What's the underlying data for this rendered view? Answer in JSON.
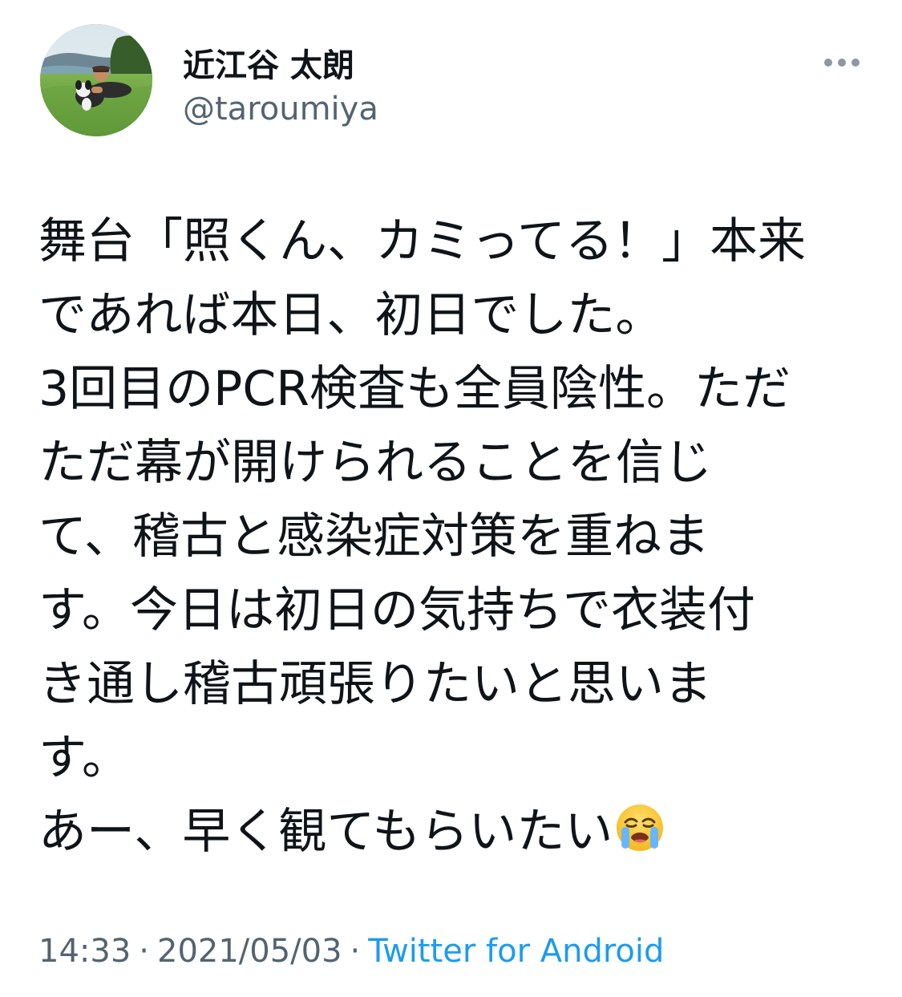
{
  "author": {
    "display_name": "近江谷 太朗",
    "handle": "@taroumiya"
  },
  "tweet": {
    "lines": [
      "舞台「照くん、カミってる！」本来",
      "であれば本日、初日でした。",
      "3回目のPCR検査も全員陰性。ただ",
      "ただ幕が開けられることを信じ",
      "て、稽古と感染症対策を重ねま",
      "す。今日は初日の気持ちで衣装付",
      "き通し稽古頑張りたいと思いま",
      "す。",
      "あー、早く観てもらいたい"
    ],
    "emoji": "loudly-crying-face"
  },
  "meta": {
    "time": "14:33",
    "separator": "·",
    "date": "2021/05/03",
    "source": "Twitter for Android"
  },
  "colors": {
    "text_primary": "#0f1419",
    "text_secondary": "#536471",
    "link": "#1d9bf0",
    "more_dots": "#8b98a5"
  },
  "icons": {
    "more": "more-horizontal-icon",
    "emoji": "crying-face-icon"
  }
}
